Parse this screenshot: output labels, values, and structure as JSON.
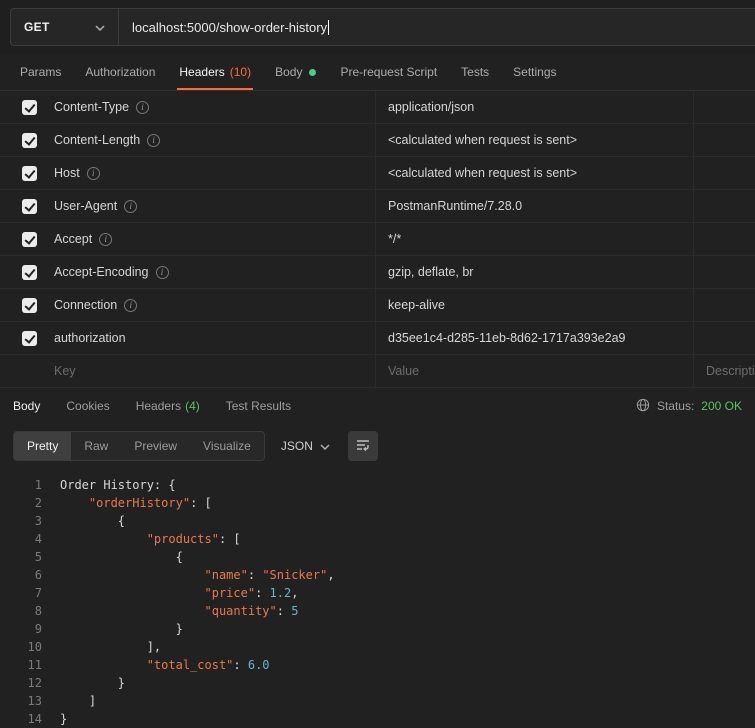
{
  "request": {
    "method": "GET",
    "url": "localhost:5000/show-order-history",
    "tabs": [
      {
        "label": "Params",
        "active": false
      },
      {
        "label": "Authorization",
        "active": false
      },
      {
        "label": "Headers",
        "count": "(10)",
        "active": true
      },
      {
        "label": "Body",
        "dot": true,
        "active": false
      },
      {
        "label": "Pre-request Script",
        "active": false
      },
      {
        "label": "Tests",
        "active": false
      },
      {
        "label": "Settings",
        "active": false
      }
    ]
  },
  "headers_table": {
    "columns": {
      "key": "Key",
      "value": "Value",
      "description": "Description"
    },
    "rows": [
      {
        "key": "Content-Type",
        "info": true,
        "checked": true,
        "value": "application/json"
      },
      {
        "key": "Content-Length",
        "info": true,
        "checked": true,
        "value": "<calculated when request is sent>"
      },
      {
        "key": "Host",
        "info": true,
        "checked": true,
        "value": "<calculated when request is sent>"
      },
      {
        "key": "User-Agent",
        "info": true,
        "checked": true,
        "value": "PostmanRuntime/7.28.0"
      },
      {
        "key": "Accept",
        "info": true,
        "checked": true,
        "value": "*/*"
      },
      {
        "key": "Accept-Encoding",
        "info": true,
        "checked": true,
        "value": "gzip, deflate, br"
      },
      {
        "key": "Connection",
        "info": true,
        "checked": true,
        "value": "keep-alive"
      },
      {
        "key": "authorization",
        "info": false,
        "checked": true,
        "value": "d35ee1c4-d285-11eb-8d62-1717a393e2a9"
      }
    ]
  },
  "response": {
    "tabs": [
      {
        "label": "Body",
        "active": true
      },
      {
        "label": "Cookies",
        "active": false
      },
      {
        "label": "Headers",
        "count": "(4)",
        "active": false
      },
      {
        "label": "Test Results",
        "active": false
      }
    ],
    "status_label": "Status:",
    "status_value": "200 OK",
    "view_tabs": [
      {
        "label": "Pretty",
        "active": true
      },
      {
        "label": "Raw",
        "active": false
      },
      {
        "label": "Preview",
        "active": false
      },
      {
        "label": "Visualize",
        "active": false
      }
    ],
    "format": "JSON",
    "code_lines": [
      {
        "line": 1,
        "tokens": [
          {
            "c": "plain",
            "t": "Order History: {"
          }
        ]
      },
      {
        "line": 2,
        "tokens": [
          {
            "c": "plain",
            "t": "    "
          },
          {
            "c": "key",
            "t": "\"orderHistory\""
          },
          {
            "c": "plain",
            "t": ": ["
          }
        ]
      },
      {
        "line": 3,
        "tokens": [
          {
            "c": "plain",
            "t": "        {"
          }
        ]
      },
      {
        "line": 4,
        "tokens": [
          {
            "c": "plain",
            "t": "            "
          },
          {
            "c": "key",
            "t": "\"products\""
          },
          {
            "c": "plain",
            "t": ": ["
          }
        ]
      },
      {
        "line": 5,
        "tokens": [
          {
            "c": "plain",
            "t": "                {"
          }
        ]
      },
      {
        "line": 6,
        "tokens": [
          {
            "c": "plain",
            "t": "                    "
          },
          {
            "c": "key",
            "t": "\"name\""
          },
          {
            "c": "plain",
            "t": ": "
          },
          {
            "c": "string",
            "t": "\"Snicker\""
          },
          {
            "c": "plain",
            "t": ","
          }
        ]
      },
      {
        "line": 7,
        "tokens": [
          {
            "c": "plain",
            "t": "                    "
          },
          {
            "c": "key",
            "t": "\"price\""
          },
          {
            "c": "plain",
            "t": ": "
          },
          {
            "c": "number",
            "t": "1.2"
          },
          {
            "c": "plain",
            "t": ","
          }
        ]
      },
      {
        "line": 8,
        "tokens": [
          {
            "c": "plain",
            "t": "                    "
          },
          {
            "c": "key",
            "t": "\"quantity\""
          },
          {
            "c": "plain",
            "t": ": "
          },
          {
            "c": "number",
            "t": "5"
          }
        ]
      },
      {
        "line": 9,
        "tokens": [
          {
            "c": "plain",
            "t": "                }"
          }
        ]
      },
      {
        "line": 10,
        "tokens": [
          {
            "c": "plain",
            "t": "            ],"
          }
        ]
      },
      {
        "line": 11,
        "tokens": [
          {
            "c": "plain",
            "t": "            "
          },
          {
            "c": "key",
            "t": "\"total_cost\""
          },
          {
            "c": "plain",
            "t": ": "
          },
          {
            "c": "number",
            "t": "6.0"
          }
        ]
      },
      {
        "line": 12,
        "tokens": [
          {
            "c": "plain",
            "t": "        }"
          }
        ]
      },
      {
        "line": 13,
        "tokens": [
          {
            "c": "plain",
            "t": "    ]"
          }
        ]
      },
      {
        "line": 14,
        "tokens": [
          {
            "c": "plain",
            "t": "}"
          }
        ]
      }
    ]
  },
  "icons": {
    "info": "i",
    "chevron_down": "chevron-down",
    "globe": "globe",
    "wrap_text": "wrap-text"
  },
  "colors": {
    "accent_orange": "#ff6c37",
    "success_green": "#5ac264",
    "json_key": "#e8794e",
    "json_string": "#e8794e",
    "json_number": "#68b5c8"
  }
}
